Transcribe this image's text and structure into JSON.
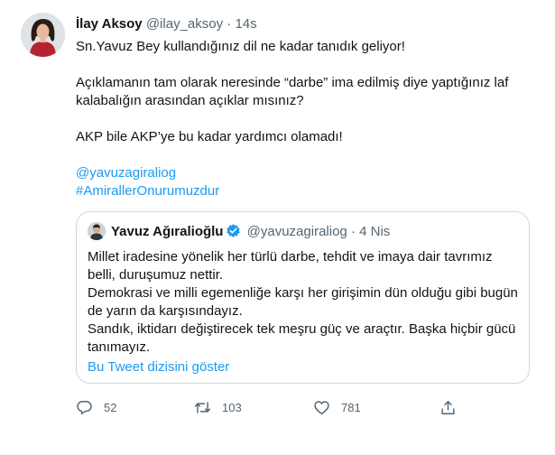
{
  "tweet": {
    "author_name": "İlay Aksoy",
    "author_handle": "@ilay_aksoy",
    "separator": "·",
    "time": "14s",
    "lines": [
      "Sn.Yavuz Bey kullandığınız dil ne kadar tanıdık geliyor!",
      "Açıklamanın tam olarak neresinde “darbe” ima edilmiş diye yaptığınız laf kalabalığın arasından açıklar mısınız?",
      "AKP bile AKP’ye bu kadar yardımcı olamadı!"
    ],
    "mention": "@yavuzagiraliog",
    "hashtag": "#AmirallerOnurumuzdur"
  },
  "quote": {
    "author_name": "Yavuz Ağıralioğlu",
    "author_handle": "@yavuzagiraliog",
    "separator": "·",
    "time": "4 Nis",
    "lines": [
      "Millet iradesine yönelik her türlü darbe, tehdit ve imaya dair tavrımız belli, duruşumuz nettir.",
      "Demokrasi ve milli egemenliğe karşı her girişimin dün olduğu gibi bugün de yarın da karşısındayız.",
      "Sandık, iktidarı değiştirecek tek meşru güç ve araçtır. Başka hiçbir gücü tanımayız."
    ],
    "show_thread": "Bu Tweet dizisini göster"
  },
  "actions": {
    "reply_count": "52",
    "retweet_count": "103",
    "like_count": "781"
  },
  "icons": [
    "reply-icon",
    "retweet-icon",
    "like-icon",
    "share-icon",
    "verified-badge-icon"
  ],
  "colors": {
    "link": "#1d9bf0",
    "secondary_text": "#536471",
    "border": "#cfd9de"
  }
}
